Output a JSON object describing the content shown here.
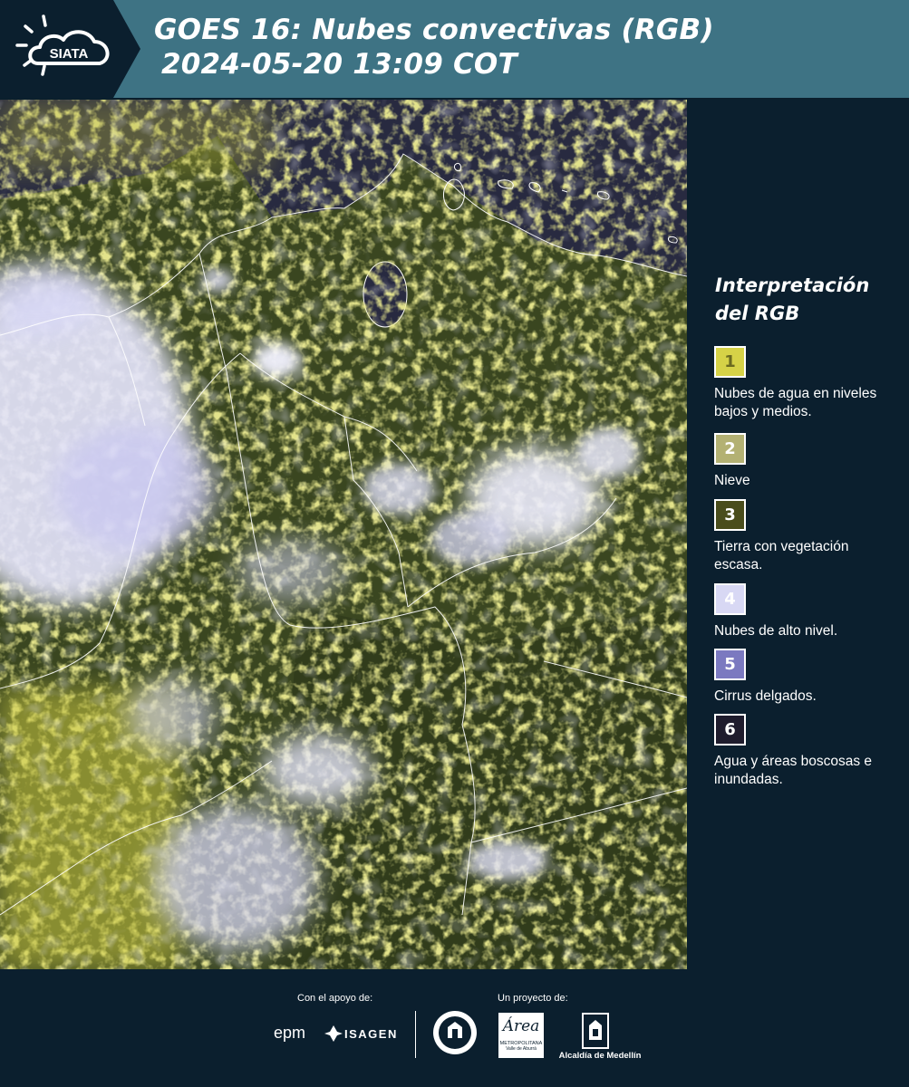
{
  "header": {
    "logo_text": "SIATA",
    "title_line1": "GOES 16: Nubes convectivas (RGB)",
    "title_line2": "2024-05-20 13:09 COT",
    "background_color": "#3e7384"
  },
  "map": {
    "image_desc": "satellite-rgb-map",
    "land_color": "#3d4a1e",
    "water_color": "#282a40",
    "low_cloud_color": "#d9d84a",
    "high_cloud_color": "#d8d8f6"
  },
  "legend": {
    "title": "Interpretación del RGB",
    "items": [
      {
        "number": "1",
        "label": "Nubes de agua en niveles bajos y medios.",
        "color": "#d6d247"
      },
      {
        "number": "2",
        "label": "Nieve",
        "color": "#b3b173"
      },
      {
        "number": "3",
        "label": "Tierra con vegetación escasa.",
        "color": "#4a4d1c"
      },
      {
        "number": "4",
        "label": "Nubes de alto nivel.",
        "color": "#d8d8f4"
      },
      {
        "number": "5",
        "label": "Cirrus delgados.",
        "color": "#7b79c0"
      },
      {
        "number": "6",
        "label": "Agua y áreas boscosas e inundadas.",
        "color": "#1f1c2d"
      }
    ]
  },
  "footer": {
    "support_label": "Con el apoyo de:",
    "project_label": "Un proyecto de:",
    "sponsor_epm": "epm",
    "sponsor_isagen": "ISAGEN",
    "area_name": "Área",
    "area_sub1": "METROPOLITANA",
    "area_sub2": "Valle de Aburrá",
    "alcaldia": "Alcaldía de Medellín"
  }
}
